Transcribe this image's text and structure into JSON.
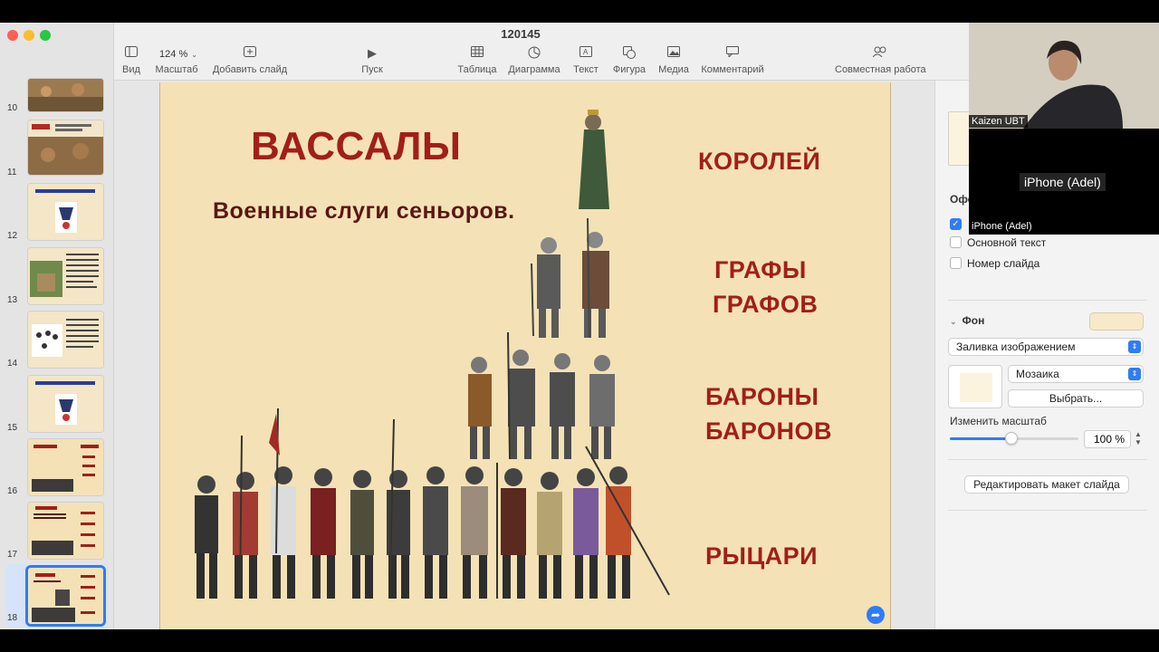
{
  "window": {
    "title": "120145"
  },
  "toolbar": {
    "view": "Вид",
    "zoom_value": "124 %",
    "zoom_label": "Масштаб",
    "add_slide": "Добавить слайд",
    "play": "Пуск",
    "table": "Таблица",
    "chart": "Диаграмма",
    "text": "Текст",
    "shape": "Фигура",
    "media": "Медиа",
    "comment": "Комментарий",
    "collaborate": "Совместная работа"
  },
  "slides": [
    {
      "num": "10"
    },
    {
      "num": "11"
    },
    {
      "num": "12"
    },
    {
      "num": "13"
    },
    {
      "num": "14"
    },
    {
      "num": "15"
    },
    {
      "num": "16"
    },
    {
      "num": "17"
    },
    {
      "num": "18"
    }
  ],
  "slide": {
    "title": "ВАССАЛЫ",
    "subtitle": "Военные слуги сеньоров.",
    "kings": "КОРОЛЕЙ",
    "counts1": "ГРАФЫ",
    "counts2": "ГРАФОВ",
    "barons1": "БАРОНЫ",
    "barons2": "БАРОНОВ",
    "knights": "РЫЦАРИ"
  },
  "inspector": {
    "section_cut": "Офо",
    "body_text": "Основной текст",
    "slide_number": "Номер слайда",
    "background": "Фон",
    "fill_type": "Заливка изображением",
    "tile_mode": "Мозаика",
    "choose": "Выбрать...",
    "scale_label": "Изменить масштаб",
    "scale_value": "100 %",
    "scale_fraction": 0.48,
    "edit_layout": "Редактировать макет слайда"
  },
  "video": {
    "participant1": "Kaizen UBT",
    "participant2": "iPhone (Adel)",
    "participant2_label": "iPhone (Adel)"
  },
  "colors": {
    "accent": "#2f7cf6",
    "slide_bg": "#f4e2b6",
    "title_red": "#a21e1a"
  }
}
